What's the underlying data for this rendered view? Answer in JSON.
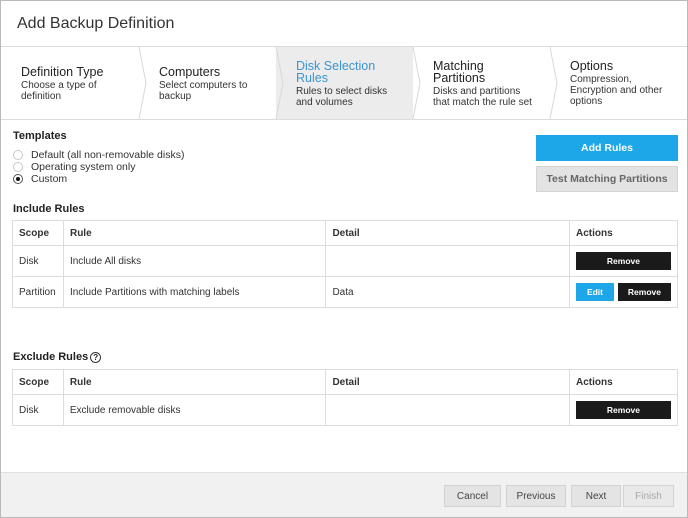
{
  "dialog": {
    "title": "Add Backup Definition"
  },
  "steps": [
    {
      "title": "Definition Type",
      "desc": [
        "Choose a type of",
        "definition"
      ]
    },
    {
      "title": "Computers",
      "desc": [
        "Select computers to",
        "backup"
      ]
    },
    {
      "title": [
        "Disk Selection",
        "Rules"
      ],
      "desc": [
        "Rules to select disks",
        "and volumes"
      ]
    },
    {
      "title": [
        "Matching",
        "Partitions"
      ],
      "desc": [
        "Disks and partitions",
        "that match the rule set"
      ]
    },
    {
      "title": "Options",
      "desc": [
        "Compression,",
        "Encryption and other",
        "options"
      ]
    }
  ],
  "templates": {
    "label": "Templates",
    "options": [
      "Default (all non-removable disks)",
      "Operating system only",
      "Custom"
    ],
    "selected": "Custom"
  },
  "buttons": {
    "add_rules": "Add Rules",
    "test_matching": "Test Matching Partitions"
  },
  "include_rules": {
    "label": "Include Rules",
    "headers": [
      "Scope",
      "Rule",
      "Detail",
      "Actions"
    ],
    "rows": [
      {
        "scope": "Disk",
        "rule": "Include All disks",
        "detail": "",
        "actions": [
          "Remove"
        ]
      },
      {
        "scope": "Partition",
        "rule": "Include Partitions with matching labels",
        "detail": "Data",
        "actions": [
          "Edit",
          "Remove"
        ]
      }
    ]
  },
  "exclude_rules": {
    "label": "Exclude Rules",
    "help_glyph": "?",
    "headers": [
      "Scope",
      "Rule",
      "Detail",
      "Actions"
    ],
    "rows": [
      {
        "scope": "Disk",
        "rule": "Exclude removable disks",
        "detail": "",
        "actions": [
          "Remove"
        ]
      }
    ]
  },
  "footer": {
    "cancel": "Cancel",
    "previous": "Previous",
    "next": "Next",
    "finish": "Finish"
  },
  "colors": {
    "accent": "#1ea7e8",
    "active_step_text": "#3a95d3",
    "dark_button": "#1a1a1a"
  }
}
